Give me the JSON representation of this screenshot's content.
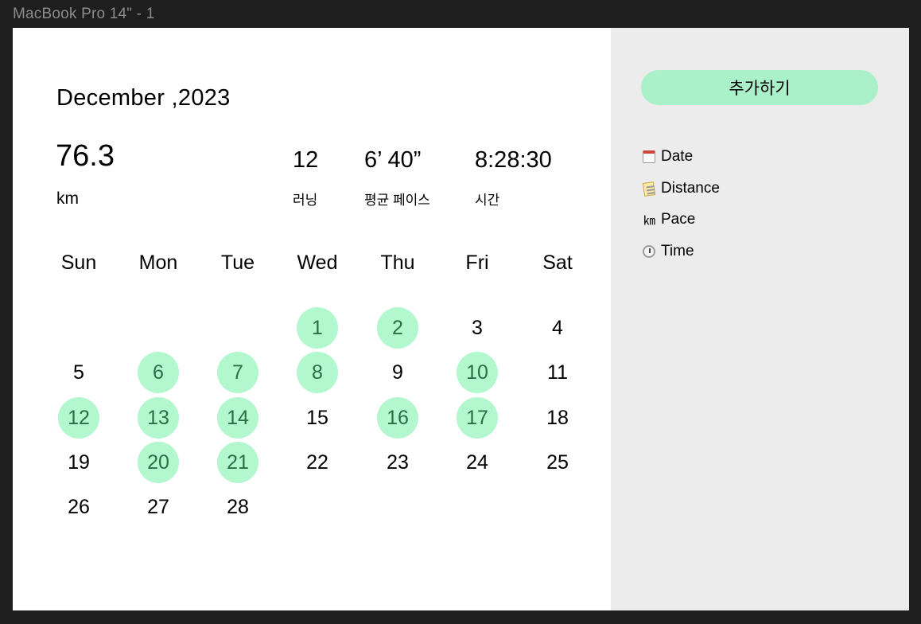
{
  "frame": {
    "title": "MacBook Pro 14\" - 1"
  },
  "calendar": {
    "month_title": "December ,2023",
    "weekdays": [
      "Sun",
      "Mon",
      "Tue",
      "Wed",
      "Thu",
      "Fri",
      "Sat"
    ],
    "weeks": [
      [
        null,
        null,
        null,
        {
          "day": "1",
          "run": true
        },
        {
          "day": "2",
          "run": true
        },
        {
          "day": "3",
          "run": false
        },
        {
          "day": "4",
          "run": false
        }
      ],
      [
        {
          "day": "5",
          "run": false
        },
        {
          "day": "6",
          "run": true
        },
        {
          "day": "7",
          "run": true
        },
        {
          "day": "8",
          "run": true
        },
        {
          "day": "9",
          "run": false
        },
        {
          "day": "10",
          "run": true
        },
        {
          "day": "11",
          "run": false
        }
      ],
      [
        {
          "day": "12",
          "run": true
        },
        {
          "day": "13",
          "run": true
        },
        {
          "day": "14",
          "run": true
        },
        {
          "day": "15",
          "run": false
        },
        {
          "day": "16",
          "run": true
        },
        {
          "day": "17",
          "run": true
        },
        {
          "day": "18",
          "run": false
        }
      ],
      [
        {
          "day": "19",
          "run": false
        },
        {
          "day": "20",
          "run": true
        },
        {
          "day": "21",
          "run": true
        },
        {
          "day": "22",
          "run": false
        },
        {
          "day": "23",
          "run": false
        },
        {
          "day": "24",
          "run": false
        },
        {
          "day": "25",
          "run": false
        }
      ],
      [
        {
          "day": "26",
          "run": false
        },
        {
          "day": "27",
          "run": false
        },
        {
          "day": "28",
          "run": false
        },
        null,
        null,
        null,
        null
      ]
    ],
    "run_color": "#b3f7cf",
    "run_text_color": "#2b6e46"
  },
  "stats": {
    "total_distance": "76.3",
    "distance_unit": "km",
    "runs_value": "12",
    "runs_label": "러닝",
    "pace_value": "6’ 40”",
    "pace_label": "평균 페이스",
    "time_value": "8:28:30",
    "time_label": "시간"
  },
  "sidebar": {
    "add_button_label": "추가하기",
    "add_button_color": "#aaf0c8",
    "fields": [
      {
        "icon": "calendar-icon",
        "label": "Date"
      },
      {
        "icon": "memo-icon",
        "label": "Distance"
      },
      {
        "icon": "km-icon",
        "icon_text": "㎞",
        "label": "Pace"
      },
      {
        "icon": "stopwatch-icon",
        "label": "Time"
      }
    ]
  }
}
